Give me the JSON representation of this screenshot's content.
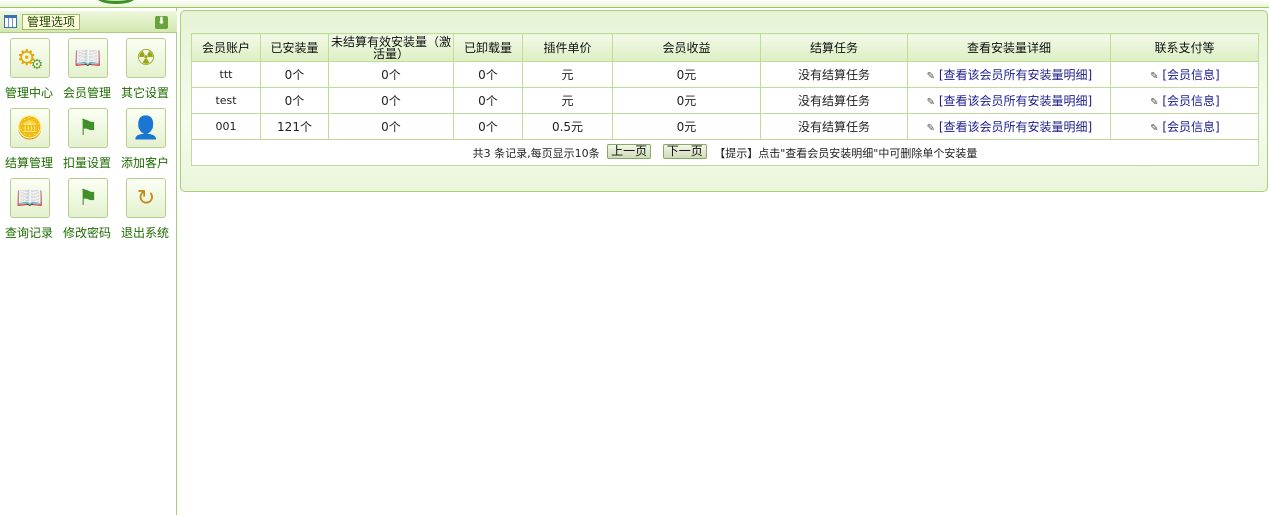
{
  "sidebar": {
    "header_title": "管理选项",
    "items": [
      {
        "label": "管理中心",
        "icon": "gears-icon"
      },
      {
        "label": "会员管理",
        "icon": "book-refresh-icon"
      },
      {
        "label": "其它设置",
        "icon": "radiation-icon"
      },
      {
        "label": "结算管理",
        "icon": "coins-icon"
      },
      {
        "label": "扣量设置",
        "icon": "flag-icon"
      },
      {
        "label": "添加客户",
        "icon": "user-add-icon"
      },
      {
        "label": "查询记录",
        "icon": "book-refresh-icon"
      },
      {
        "label": "修改密码",
        "icon": "flags-icon"
      },
      {
        "label": "退出系统",
        "icon": "exit-refresh-icon"
      }
    ]
  },
  "table": {
    "headers": [
      "会员账户",
      "已安装量",
      "未结算有效安装量（激活量）",
      "已卸载量",
      "插件单价",
      "会员收益",
      "结算任务",
      "查看安装量详细",
      "联系支付等"
    ],
    "rows": [
      {
        "account": "ttt",
        "installed": "0个",
        "unsettled": "0个",
        "uninstalled": "0个",
        "price": "元",
        "income": "0元",
        "task": "没有结算任务",
        "detail": "[查看该会员所有安装量明细]",
        "contact": "[会员信息]"
      },
      {
        "account": "test",
        "installed": "0个",
        "unsettled": "0个",
        "uninstalled": "0个",
        "price": "元",
        "income": "0元",
        "task": "没有结算任务",
        "detail": "[查看该会员所有安装量明细]",
        "contact": "[会员信息]"
      },
      {
        "account": "001",
        "installed": "121个",
        "unsettled": "0个",
        "uninstalled": "0个",
        "price": "0.5元",
        "income": "0元",
        "task": "没有结算任务",
        "detail": "[查看该会员所有安装量明细]",
        "contact": "[会员信息]"
      }
    ]
  },
  "footer": {
    "summary": "共3 条记录,每页显示10条",
    "prev": "上一页",
    "next": "下一页",
    "tip": "【提示】点击\"查看会员安装明细\"中可删除单个安装量"
  },
  "colors": {
    "accent_green": "#1e6b00",
    "border_green": "#bedc9a",
    "panel_bg": "#e6f3d4"
  }
}
